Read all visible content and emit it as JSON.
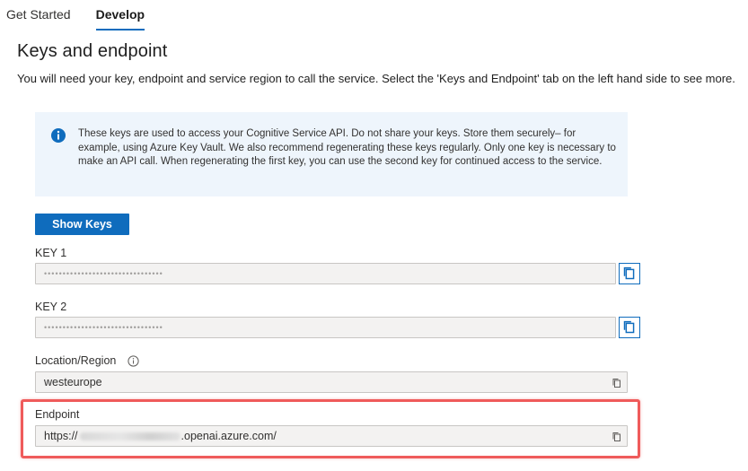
{
  "tabs": [
    {
      "label": "Get Started"
    },
    {
      "label": "Develop"
    }
  ],
  "section": {
    "title": "Keys and endpoint",
    "description": "You will need your key, endpoint and service region to call the service. Select the 'Keys and Endpoint' tab on the left hand side to see more."
  },
  "info": {
    "icon": "info-icon",
    "text": "These keys are used to access your Cognitive Service API. Do not share your keys. Store them securely– for example, using Azure Key Vault. We also recommend regenerating these keys regularly. Only one key is necessary to make an API call. When regenerating the first key, you can use the second key for continued access to the service."
  },
  "show_keys_label": "Show Keys",
  "key1": {
    "label": "KEY 1",
    "value": "••••••••••••••••••••••••••••••••"
  },
  "key2": {
    "label": "KEY 2",
    "value": "••••••••••••••••••••••••••••••••"
  },
  "location": {
    "label": "Location/Region",
    "value": "westeurope"
  },
  "endpoint": {
    "label": "Endpoint",
    "value_prefix": "https://",
    "value_suffix": ".openai.azure.com/"
  },
  "colors": {
    "accent": "#0f6cbd",
    "info_background": "#eef5fc",
    "highlight": "#ef5b5b"
  }
}
